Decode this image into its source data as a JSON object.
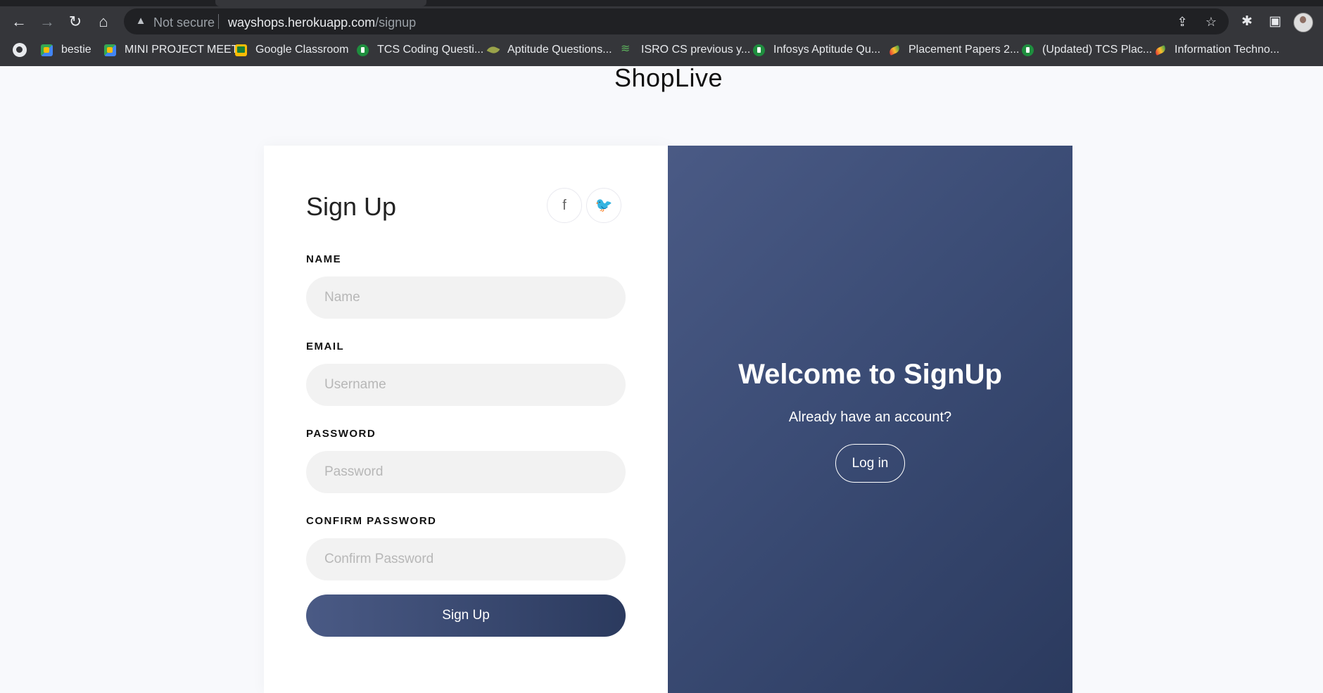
{
  "browser": {
    "security_label": "Not secure",
    "url_host": "wayshops.herokuapp.com",
    "url_path": "/signup",
    "icons": [
      "back-icon",
      "forward-icon",
      "reload-icon",
      "home-icon",
      "warning-icon",
      "share-icon",
      "star-icon",
      "extensions-icon",
      "sidepanel-icon",
      "profile-avatar"
    ]
  },
  "bookmarks": [
    {
      "label": "bestie",
      "icon": "meet"
    },
    {
      "label": "MINI PROJECT MEET",
      "icon": "meet"
    },
    {
      "label": "Google Classroom",
      "icon": "classroom"
    },
    {
      "label": "TCS Coding Questi...",
      "icon": "shield"
    },
    {
      "label": "Aptitude Questions...",
      "icon": "leaf"
    },
    {
      "label": "ISRO CS previous y...",
      "icon": "isro"
    },
    {
      "label": "Infosys Aptitude Qu...",
      "icon": "shield"
    },
    {
      "label": "Placement Papers 2...",
      "icon": "paper"
    },
    {
      "label": "(Updated) TCS Plac...",
      "icon": "shield"
    },
    {
      "label": "Information Techno...",
      "icon": "paper"
    }
  ],
  "page": {
    "brand": "ShopLive"
  },
  "form": {
    "title": "Sign Up",
    "social_icons": [
      "facebook-icon",
      "twitter-icon"
    ],
    "name_label": "NAME",
    "name_placeholder": "Name",
    "email_label": "EMAIL",
    "email_placeholder": "Username",
    "password_label": "PASSWORD",
    "password_placeholder": "Password",
    "confirm_label": "CONFIRM PASSWORD",
    "confirm_placeholder": "Confirm Password",
    "submit_label": "Sign Up"
  },
  "welcome_panel": {
    "heading": "Welcome to SignUp",
    "subtext": "Already have an account?",
    "login_label": "Log in"
  },
  "colors": {
    "panel_start": "#4a5a85",
    "panel_end": "#2b3a5e",
    "page_bg": "#f8f9fc",
    "input_bg": "#f2f2f2"
  }
}
